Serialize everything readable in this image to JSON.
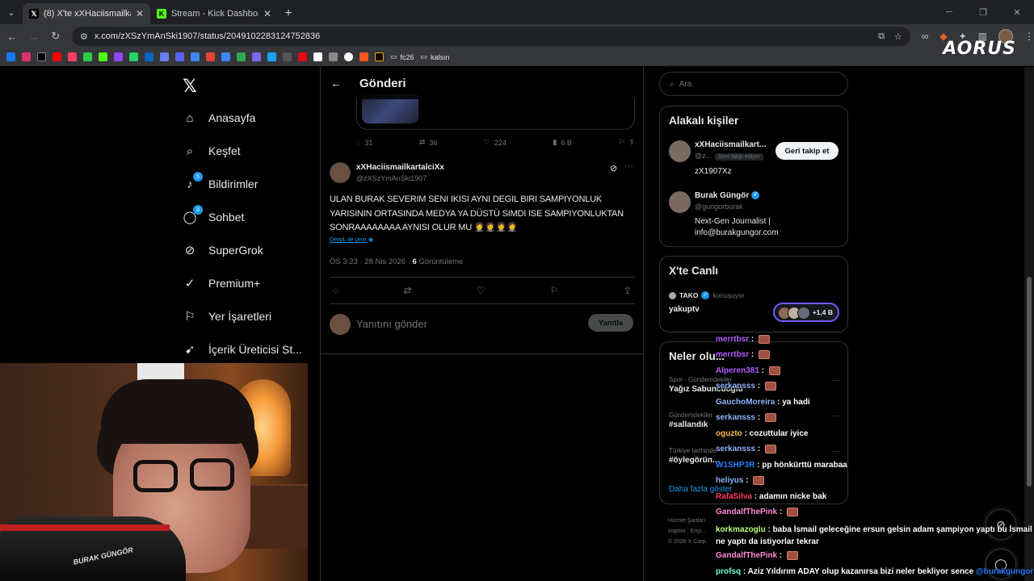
{
  "browser": {
    "tabs": [
      {
        "title": "(8) X'te xXHaciismailkartalciXx: \"ULA",
        "active": true
      },
      {
        "title": "Stream - Kick Dashboard",
        "active": false
      }
    ],
    "url": "x.com/zXSzYmAnSki1907/status/2049102283124752836",
    "bookmarks": [
      {
        "label": "fc26"
      },
      {
        "label": "kalsın"
      }
    ],
    "overlay_brand": "AORUS"
  },
  "nav": {
    "items": [
      {
        "label": "Anasayfa",
        "icon": "home-icon"
      },
      {
        "label": "Keşfet",
        "icon": "search-icon"
      },
      {
        "label": "Bildirimler",
        "icon": "bell-icon",
        "badge": "5"
      },
      {
        "label": "Sohbet",
        "icon": "chat-icon",
        "badge": "3"
      },
      {
        "label": "SuperGrok",
        "icon": "grok-icon"
      },
      {
        "label": "Premium+",
        "icon": "verified-icon"
      },
      {
        "label": "Yer İşaretleri",
        "icon": "bookmark-icon"
      },
      {
        "label": "İçerik Üreticisi St...",
        "icon": "rocket-icon"
      }
    ]
  },
  "post": {
    "header_title": "Gönderi",
    "parent_stats": {
      "replies": "31",
      "reposts": "36",
      "likes": "224",
      "views": "6 B"
    },
    "author_name": "xXHaciismailkartalciXx",
    "author_handle": "@zXSzYmAnSki1907",
    "text": "ULAN BURAK SEVERIM SENI IKISI AYNI DEGIL BIRI SAMPIYONLUK YARISININ ORTASINDA MEDYA YA DÜSTÜ SIMDI ISE SAMPIYONLUKTAN SONRAAAAAAAA AYNISI OLUR MU 🤵🤵🤵🤵",
    "translate_label": "DeepL ile çevir",
    "time": "ÖS 3:23 · 28 Nis 2026 · ",
    "views_count": "6",
    "views_label": " Görüntüleme",
    "reply_placeholder": "Yanıtını gönder",
    "reply_button": "Yanıtla"
  },
  "right": {
    "search_placeholder": "Ara",
    "related_title": "Alakalı kişiler",
    "people": [
      {
        "name": "xXHaciismailkart...",
        "handle": "@z...",
        "follows_you": "Seni takip ediyor",
        "bio": "zX1907Xz",
        "button": "Geri takip et"
      },
      {
        "name": "Burak Güngör",
        "handle": "@gungorburak",
        "bio": "Next-Gen Journalist | info@burakgungor.com"
      }
    ],
    "live_title": "X'te Canlı",
    "live_host": "TAKO",
    "live_host_status": "konuşuyor",
    "live_space": "yakuptv",
    "live_count": "+1,4 B",
    "trends_title": "Neler olu...",
    "trends": [
      {
        "category": "Spor · Gündemdekiler",
        "name": "Yağız Sabuncuoğlu"
      },
      {
        "category": "Gündemdekiler",
        "name": "#sallandık"
      },
      {
        "category": "Türkiye tarihinde",
        "name": "#öylegörün..."
      }
    ],
    "show_more": "Daha fazla göster",
    "footer": [
      "Hizmet Şartları",
      "Imprint · Erişi...",
      "© 2026 X Corp."
    ]
  },
  "webcam": {
    "logo": "BURAK GÜNGÖR"
  },
  "chat": [
    {
      "user": "merrtbsr",
      "color": "#b45bff",
      "msg": "",
      "emote": true
    },
    {
      "user": "merrtbsr",
      "color": "#b45bff",
      "msg": "",
      "emote": true
    },
    {
      "user": "Alperen381",
      "color": "#b45bff",
      "msg": "",
      "emote": true
    },
    {
      "user": "serkansss",
      "color": "#8fb4ff",
      "msg": "",
      "emote": true
    },
    {
      "user": "GauchoMoreira",
      "color": "#8fb4ff",
      "msg": "ya hadi"
    },
    {
      "user": "serkansss",
      "color": "#8fb4ff",
      "msg": "",
      "emote": true
    },
    {
      "user": "oguzto",
      "color": "#ffb84d",
      "msg": "cozuttular iyice"
    },
    {
      "user": "serkansss",
      "color": "#8fb4ff",
      "msg": "",
      "emote": true
    },
    {
      "user": "W1SHP3R",
      "color": "#2a7bff",
      "msg": "pp hönkürttü marabaa"
    },
    {
      "user": "heliyus",
      "color": "#8fb4ff",
      "msg": "",
      "emote": true
    },
    {
      "user": "RafaSilva",
      "color": "#ff3b5c",
      "msg": "adamın nicke bak"
    },
    {
      "user": "GandalfThePink",
      "color": "#ff8ad8",
      "msg": "",
      "emote": true
    },
    {
      "user": "korkmazoglu",
      "color": "#baff7a",
      "msg": "baba İsmail geleceğine ersun gelsin adam şampiyon yaptı bu İsmail ne yaptı da istiyorlar tekrar"
    },
    {
      "user": "GandalfThePink",
      "color": "#ff8ad8",
      "msg": "",
      "emote": true
    },
    {
      "user": "profsq",
      "color": "#6effd8",
      "msg": "Aziz Yıldırım ADAY olup kazanırsa bizi neler bekliyor sence",
      "mention": "@burakgungor"
    }
  ]
}
